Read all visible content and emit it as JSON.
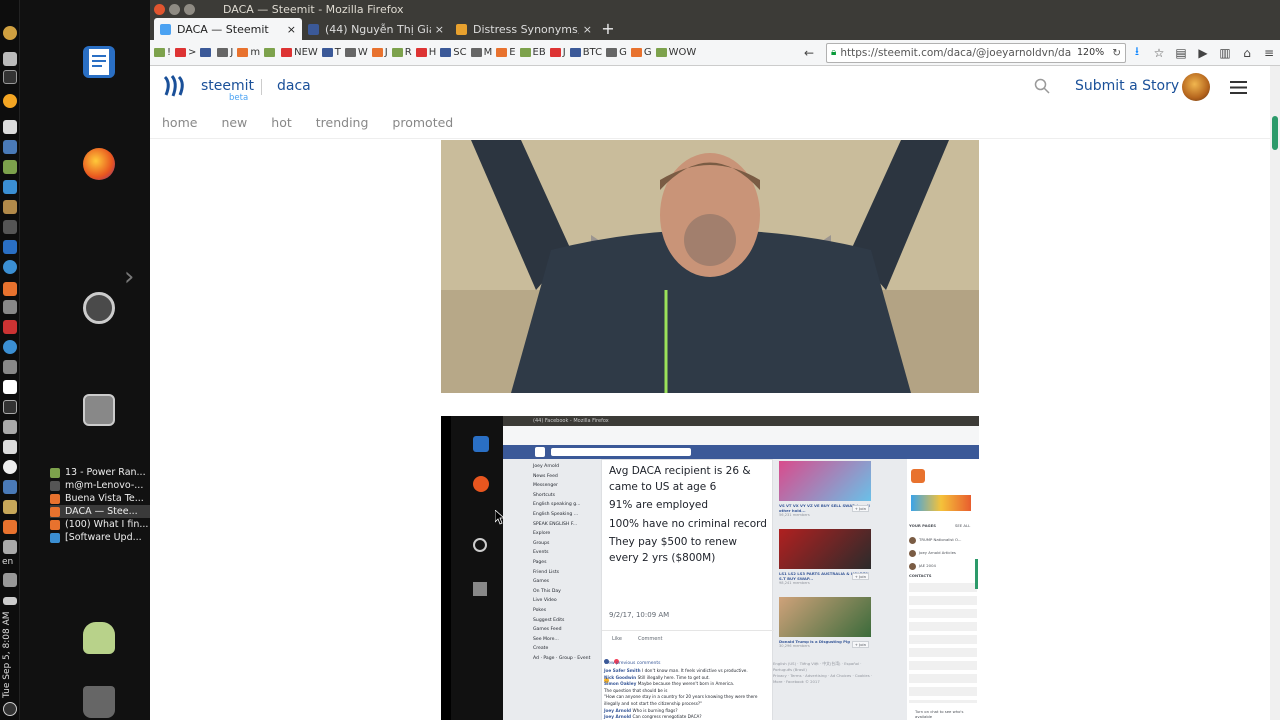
{
  "system": {
    "clock": "Tue Sep 5, 8:08 AM",
    "lang": "en"
  },
  "launcher": {
    "windows": [
      {
        "label": "13 - Power Ran...",
        "color": "#7da24c"
      },
      {
        "label": "m@m-Lenovo-...",
        "color": "#555555"
      },
      {
        "label": "Buena Vista Te...",
        "color": "#e8722e"
      },
      {
        "label": "DACA — Stee...",
        "color": "#e8722e",
        "active": true
      },
      {
        "label": "(100) What I fin...",
        "color": "#e8722e"
      },
      {
        "label": "[Software Upd...",
        "color": "#3b8fd3"
      }
    ]
  },
  "browser": {
    "window_title": "DACA — Steemit - Mozilla Firefox",
    "tabs": [
      {
        "label": "DACA — Steemit",
        "favicon_color": "#4ba2f2",
        "active": true
      },
      {
        "label": "(44) Nguyễn Thị Giang",
        "favicon_color": "#3b5998"
      },
      {
        "label": "Distress Synonyms, Di",
        "favicon_color": "#e8a12e"
      }
    ],
    "bookmarks": [
      "!",
      ">",
      "",
      "J",
      "m",
      "",
      "NEW",
      "T",
      "W",
      "J",
      "R",
      "H",
      "SC",
      "M",
      "E",
      "EB",
      "J",
      "BTC",
      "G",
      "G",
      "WOW"
    ],
    "url": "https://steemit.com/daca/@joeyarnoldvn/da",
    "zoom": "120%"
  },
  "steemit": {
    "brand": "steemit",
    "beta": "beta",
    "tag": "daca",
    "submit": "Submit a Story",
    "nav": [
      "home",
      "new",
      "hot",
      "trending",
      "promoted"
    ]
  },
  "screenshot": {
    "inner_title": "(44) Facebook - Mozilla Firefox",
    "post_lines": [
      "Avg DACA recipient is 26 & came to US at age 6",
      "91% are employed",
      "100% have no criminal record",
      "They pay $500 to renew every 2 yrs ($800M)"
    ],
    "post_date": "9/2/17, 10:09 AM",
    "like": "Like",
    "comment": "Comment",
    "sidebar_items": [
      "Joey Arnold",
      "News Feed",
      "Messenger",
      "Shortcuts",
      "English speaking g...",
      "English Speaking ...",
      "SPEAK ENGLISH F...",
      "Explore",
      "Groups",
      "Events",
      "Pages",
      "Friend Lists",
      "Games",
      "On This Day",
      "Live Video",
      "Pokes",
      "Suggest Edits",
      "Games Feed",
      "See More...",
      "Create",
      "Ad · Page · Group · Event"
    ],
    "comments": [
      {
        "name": "Joe Safer Smith",
        "text": "I don't know man. It feels vindictive vs productive."
      },
      {
        "name": "Nick Goodwin",
        "text": "Still illegally here. Time to get out."
      },
      {
        "name": "Simon Oakley",
        "text": "Maybe because they weren't born in America."
      },
      {
        "name": "",
        "text": "The question that should be is"
      },
      {
        "name": "",
        "text": "\"How can anyone stay in a country for 20 years knowing they were there illegally and not start the citizenship process?\""
      },
      {
        "name": "Joey Arnold",
        "text": "Who is burning flags?"
      },
      {
        "name": "Joey Arnold",
        "text": "Can congress renegotiate DACA?"
      }
    ],
    "view_previous": "View previous comments",
    "right_ads": [
      {
        "title": "VS VT VX VY VZ VE BUY SELL SWAP (on all other hold...",
        "sub": "56,231 members"
      },
      {
        "title": "LS1 LS2 LS3 PARTS AUSTRALIA & HOLDEN S.T BUY SWAP...",
        "sub": "98,241 members"
      },
      {
        "title": "Donald Trump is a Disgusting Pig",
        "sub": "30,296 members"
      }
    ],
    "your_pages": "YOUR PAGES",
    "see_all": "SEE ALL",
    "pages": [
      "TRUMP Nationalist O...",
      "Joey Arnold Articles",
      "JAE 2004"
    ],
    "contacts": "CONTACTS",
    "language_line": "English (US) · Tiếng Việt · 中文(台湾) · Español · Português (Brasil)",
    "footer_links": "Privacy · Terms · Advertising · Ad Choices · Cookies · More · Facebook © 2017",
    "turn_on_chat": "Turn on chat to see who's available",
    "join": "+ Join"
  }
}
